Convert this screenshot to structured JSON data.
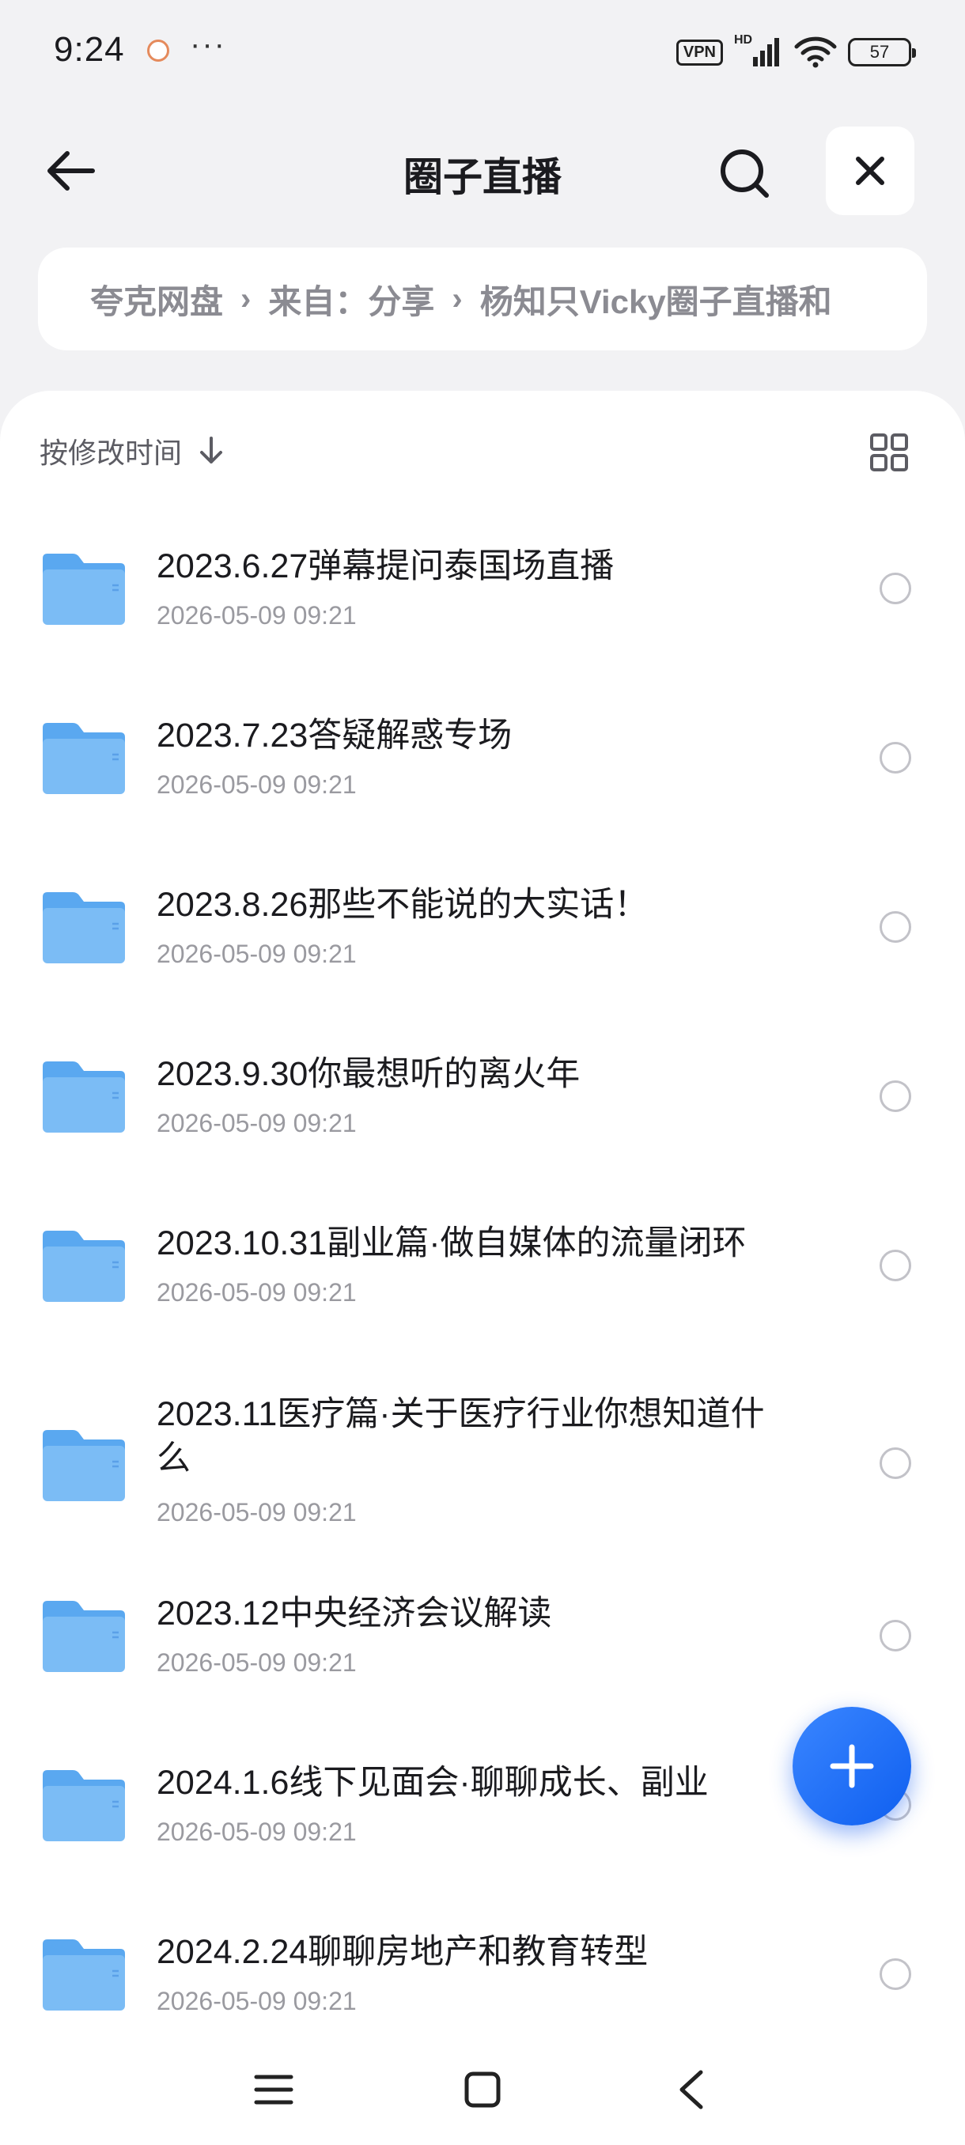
{
  "status_bar": {
    "time": "9:24",
    "dots": "···",
    "vpn": "VPN",
    "hd": "HD",
    "battery": "57"
  },
  "header": {
    "title": "圈子直播"
  },
  "breadcrumb": {
    "items": [
      "夸克网盘",
      "来自：分享",
      "杨知只Vicky圈子直播和"
    ]
  },
  "sort": {
    "label": "按修改时间"
  },
  "files": [
    {
      "name": "2023.6.27弹幕提问泰国场直播",
      "date": "2026-05-09 09:21"
    },
    {
      "name": "2023.7.23答疑解惑专场",
      "date": "2026-05-09 09:21"
    },
    {
      "name": "2023.8.26那些不能说的大实话！",
      "date": "2026-05-09 09:21"
    },
    {
      "name": "2023.9.30你最想听的离火年",
      "date": "2026-05-09 09:21"
    },
    {
      "name": "2023.10.31副业篇·做自媒体的流量闭环",
      "date": "2026-05-09 09:21"
    },
    {
      "name": "2023.11医疗篇·关于医疗行业你想知道什么",
      "date": "2026-05-09 09:21"
    },
    {
      "name": "2023.12中央经济会议解读",
      "date": "2026-05-09 09:21"
    },
    {
      "name": "2024.1.6线下见面会·聊聊成长、副业",
      "date": "2026-05-09 09:21"
    },
    {
      "name": "2024.2.24聊聊房地产和教育转型",
      "date": "2026-05-09 09:21"
    }
  ],
  "colors": {
    "accent": "#1a6cf5",
    "folder": "#7bbcf5"
  }
}
